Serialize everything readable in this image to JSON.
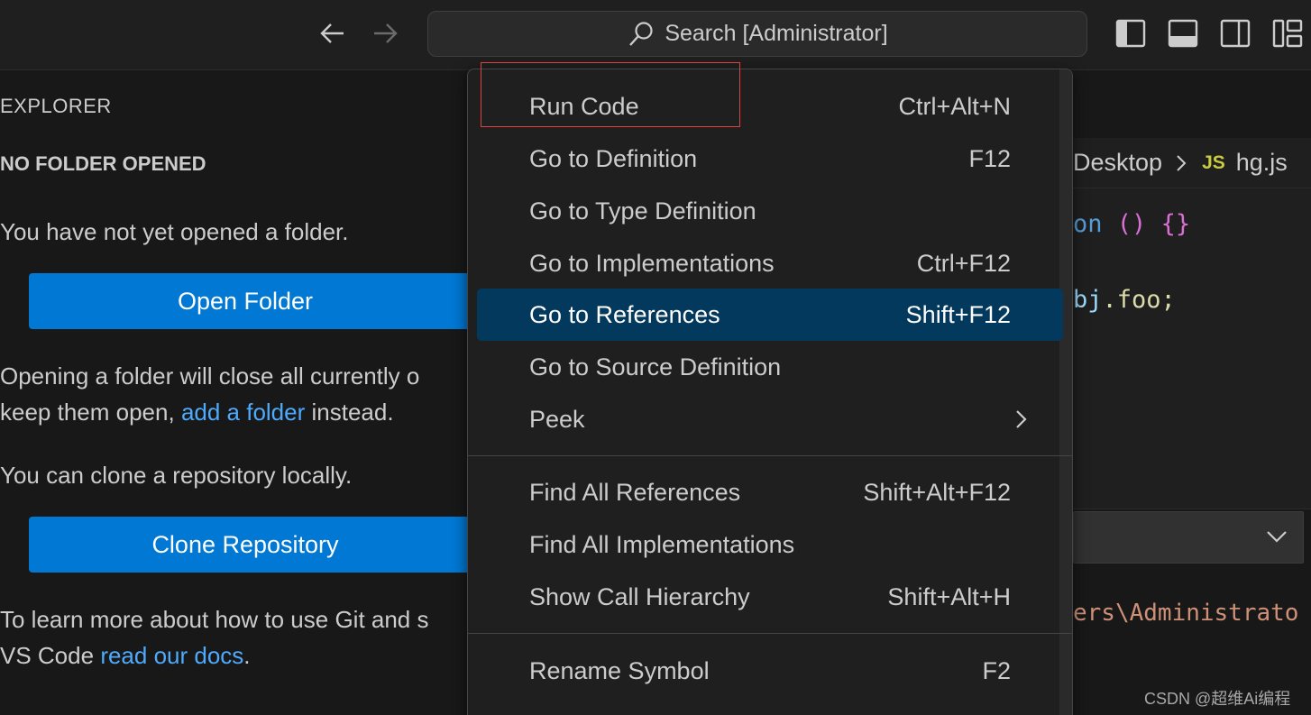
{
  "titlebar": {
    "search_text": "Search [Administrator]"
  },
  "sidebar": {
    "title": "EXPLORER",
    "section": "NO FOLDER OPENED",
    "no_folder_text": "You have not yet opened a folder.",
    "open_folder_label": "Open Folder",
    "opening_text_1": "Opening a folder will close all currently o",
    "opening_text_2_prefix": "keep them open,",
    "add_folder_link": "add a folder",
    "opening_text_2_suffix": "instead.",
    "clone_text": "You can clone a repository locally.",
    "clone_button_label": "Clone Repository",
    "learn_text_1": "To learn more about how to use Git and s",
    "learn_text_2_prefix": "VS Code",
    "read_docs_link": "read our docs",
    "learn_text_2_suffix": "."
  },
  "editor": {
    "breadcrumb_folder": "Desktop",
    "breadcrumb_file_icon": "JS",
    "breadcrumb_file": "hg.js",
    "code_line_1_keyword": "on",
    "code_line_1_parens": "()",
    "code_line_1_braces": "{}",
    "code_line_2_obj": "bj",
    "code_line_2_rest": ".foo;",
    "terminal_text": "ers\\Administrato"
  },
  "context_menu": {
    "items": [
      {
        "label": "Run Code",
        "shortcut": "Ctrl+Alt+N"
      },
      {
        "label": "Go to Definition",
        "shortcut": "F12"
      },
      {
        "label": "Go to Type Definition",
        "shortcut": ""
      },
      {
        "label": "Go to Implementations",
        "shortcut": "Ctrl+F12"
      },
      {
        "label": "Go to References",
        "shortcut": "Shift+F12"
      },
      {
        "label": "Go to Source Definition",
        "shortcut": ""
      },
      {
        "label": "Peek",
        "shortcut": ""
      },
      {
        "label": "Find All References",
        "shortcut": "Shift+Alt+F12"
      },
      {
        "label": "Find All Implementations",
        "shortcut": ""
      },
      {
        "label": "Show Call Hierarchy",
        "shortcut": "Shift+Alt+H"
      },
      {
        "label": "Rename Symbol",
        "shortcut": "F2"
      }
    ]
  },
  "watermark": "CSDN @超维Ai编程",
  "colors": {
    "accent_button": "#0078d4",
    "link": "#4daafc",
    "menu_active": "#04395e",
    "highlight_box": "#e0433e"
  }
}
